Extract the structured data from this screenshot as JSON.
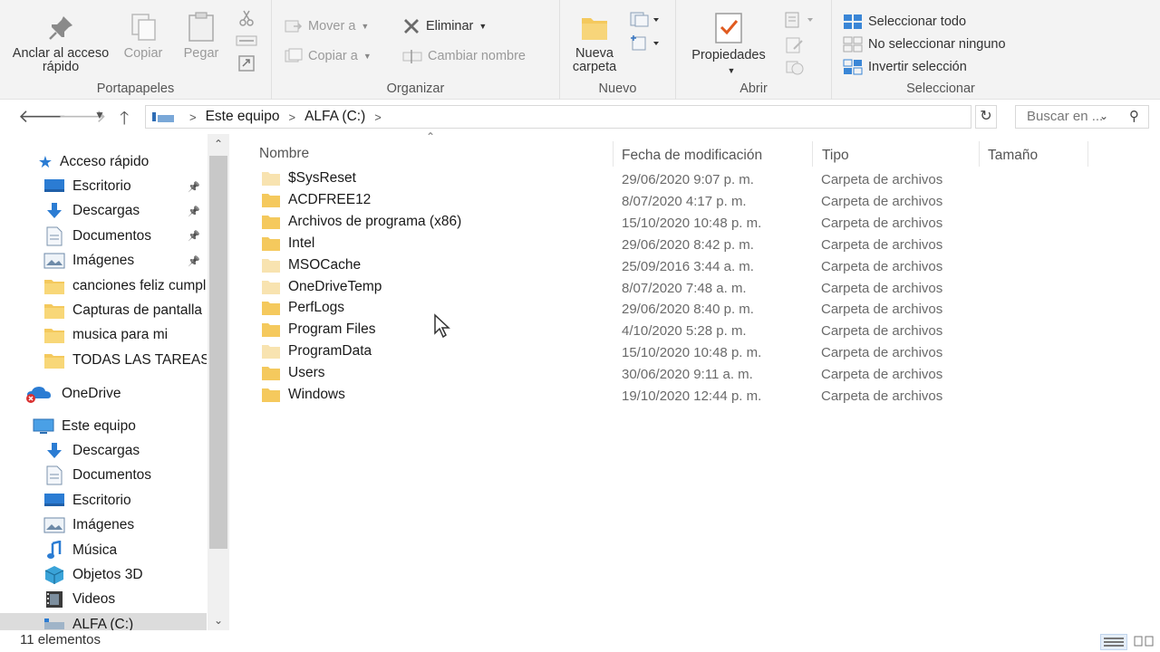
{
  "ribbon": {
    "portapapeles": {
      "label": "Portapapeles",
      "pin_quick": "Anclar al acceso rápido",
      "copy": "Copiar",
      "paste": "Pegar"
    },
    "organizar": {
      "label": "Organizar",
      "move_to": "Mover a",
      "copy_to": "Copiar a",
      "delete": "Eliminar",
      "rename": "Cambiar nombre"
    },
    "nuevo": {
      "label": "Nuevo",
      "new_folder": "Nueva carpeta"
    },
    "abrir": {
      "label": "Abrir",
      "properties": "Propiedades"
    },
    "seleccionar": {
      "label": "Seleccionar",
      "select_all": "Seleccionar todo",
      "select_none": "No seleccionar ninguno",
      "invert": "Invertir selección"
    }
  },
  "address": {
    "path": [
      "Este equipo",
      "ALFA (C:)"
    ],
    "search_placeholder": "Buscar en ..."
  },
  "sidebar": {
    "quick_access": "Acceso rápido",
    "quick_items": [
      {
        "label": "Escritorio",
        "icon": "desktop-icon",
        "pinned": true
      },
      {
        "label": "Descargas",
        "icon": "download-icon",
        "pinned": true
      },
      {
        "label": "Documentos",
        "icon": "document-icon",
        "pinned": true
      },
      {
        "label": "Imágenes",
        "icon": "image-icon",
        "pinned": true
      },
      {
        "label": "canciones feliz cumple",
        "icon": "folder-icon",
        "pinned": false
      },
      {
        "label": "Capturas de pantalla",
        "icon": "folder-icon",
        "pinned": false
      },
      {
        "label": "musica para mi",
        "icon": "folder-icon",
        "pinned": false
      },
      {
        "label": "TODAS LAS TAREAS",
        "icon": "folder-icon",
        "pinned": false
      }
    ],
    "onedrive": "OneDrive",
    "this_pc": "Este equipo",
    "pc_items": [
      {
        "label": "Descargas",
        "icon": "download-icon"
      },
      {
        "label": "Documentos",
        "icon": "document-icon"
      },
      {
        "label": "Escritorio",
        "icon": "desktop-icon"
      },
      {
        "label": "Imágenes",
        "icon": "image-icon"
      },
      {
        "label": "Música",
        "icon": "music-icon"
      },
      {
        "label": "Objetos 3D",
        "icon": "cube-icon"
      },
      {
        "label": "Videos",
        "icon": "video-icon"
      },
      {
        "label": "ALFA (C:)",
        "icon": "drive-icon"
      }
    ]
  },
  "columns": {
    "name": "Nombre",
    "modified": "Fecha de modificación",
    "type": "Tipo",
    "size": "Tamaño"
  },
  "files": [
    {
      "name": "$SysReset",
      "modified": "29/06/2020 9:07 p. m.",
      "type": "Carpeta de archivos",
      "faded": true
    },
    {
      "name": "ACDFREE12",
      "modified": "8/07/2020 4:17 p. m.",
      "type": "Carpeta de archivos",
      "faded": false
    },
    {
      "name": "Archivos de programa (x86)",
      "modified": "15/10/2020 10:48 p. m.",
      "type": "Carpeta de archivos",
      "faded": false
    },
    {
      "name": "Intel",
      "modified": "29/06/2020 8:42 p. m.",
      "type": "Carpeta de archivos",
      "faded": false
    },
    {
      "name": "MSOCache",
      "modified": "25/09/2016 3:44 a. m.",
      "type": "Carpeta de archivos",
      "faded": true
    },
    {
      "name": "OneDriveTemp",
      "modified": "8/07/2020 7:48 a. m.",
      "type": "Carpeta de archivos",
      "faded": true
    },
    {
      "name": "PerfLogs",
      "modified": "29/06/2020 8:40 p. m.",
      "type": "Carpeta de archivos",
      "faded": false
    },
    {
      "name": "Program Files",
      "modified": "4/10/2020 5:28 p. m.",
      "type": "Carpeta de archivos",
      "faded": false
    },
    {
      "name": "ProgramData",
      "modified": "15/10/2020 10:48 p. m.",
      "type": "Carpeta de archivos",
      "faded": true
    },
    {
      "name": "Users",
      "modified": "30/06/2020 9:11 a. m.",
      "type": "Carpeta de archivos",
      "faded": false
    },
    {
      "name": "Windows",
      "modified": "19/10/2020 12:44 p. m.",
      "type": "Carpeta de archivos",
      "faded": false
    }
  ],
  "status": {
    "count": "11 elementos"
  },
  "colors": {
    "folder": "#f4c95d",
    "folder_faded": "#f8e3b0",
    "accent": "#0078d7"
  }
}
